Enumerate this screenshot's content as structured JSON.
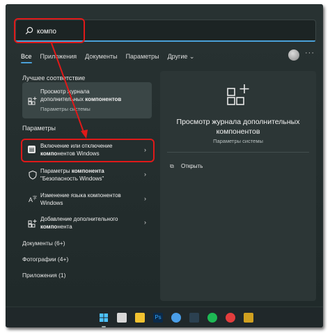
{
  "search": {
    "value": "компо",
    "placeholder": ""
  },
  "tabs": [
    {
      "label": "Все"
    },
    {
      "label": "Приложения"
    },
    {
      "label": "Документы"
    },
    {
      "label": "Параметры"
    },
    {
      "label": "Другие ⌄"
    }
  ],
  "best_match": {
    "section": "Лучшее соответствие",
    "title_line1": "Просмотр журнала",
    "title_line2_prefix": "дополнительных ",
    "title_line2_bold": "компонентов",
    "subtitle": "Параметры системы"
  },
  "settings": {
    "section": "Параметры",
    "items": [
      {
        "line1": "Включение или отключение",
        "line2_bold": "компо",
        "line2_rest": "нентов Windows"
      },
      {
        "line1_prefix": "Параметры ",
        "line1_bold": "компонента",
        "line2": "\"Безопасность Windows\""
      },
      {
        "line1": "Изменение языка компонентов",
        "line2": "Windows"
      },
      {
        "line1": "Добавление дополнительного",
        "line2_bold": "компо",
        "line2_rest": "нента"
      }
    ]
  },
  "categories": [
    {
      "label": "Документы (6+)"
    },
    {
      "label": "Фотографии (4+)"
    },
    {
      "label": "Приложения (1)"
    }
  ],
  "preview": {
    "title_line1": "Просмотр журнала дополнительных",
    "title_line2": "компонентов",
    "subtitle": "Параметры системы",
    "open_label": "Открыть"
  },
  "colors": {
    "accent": "#4aa0d8",
    "highlight": "#e01919"
  }
}
